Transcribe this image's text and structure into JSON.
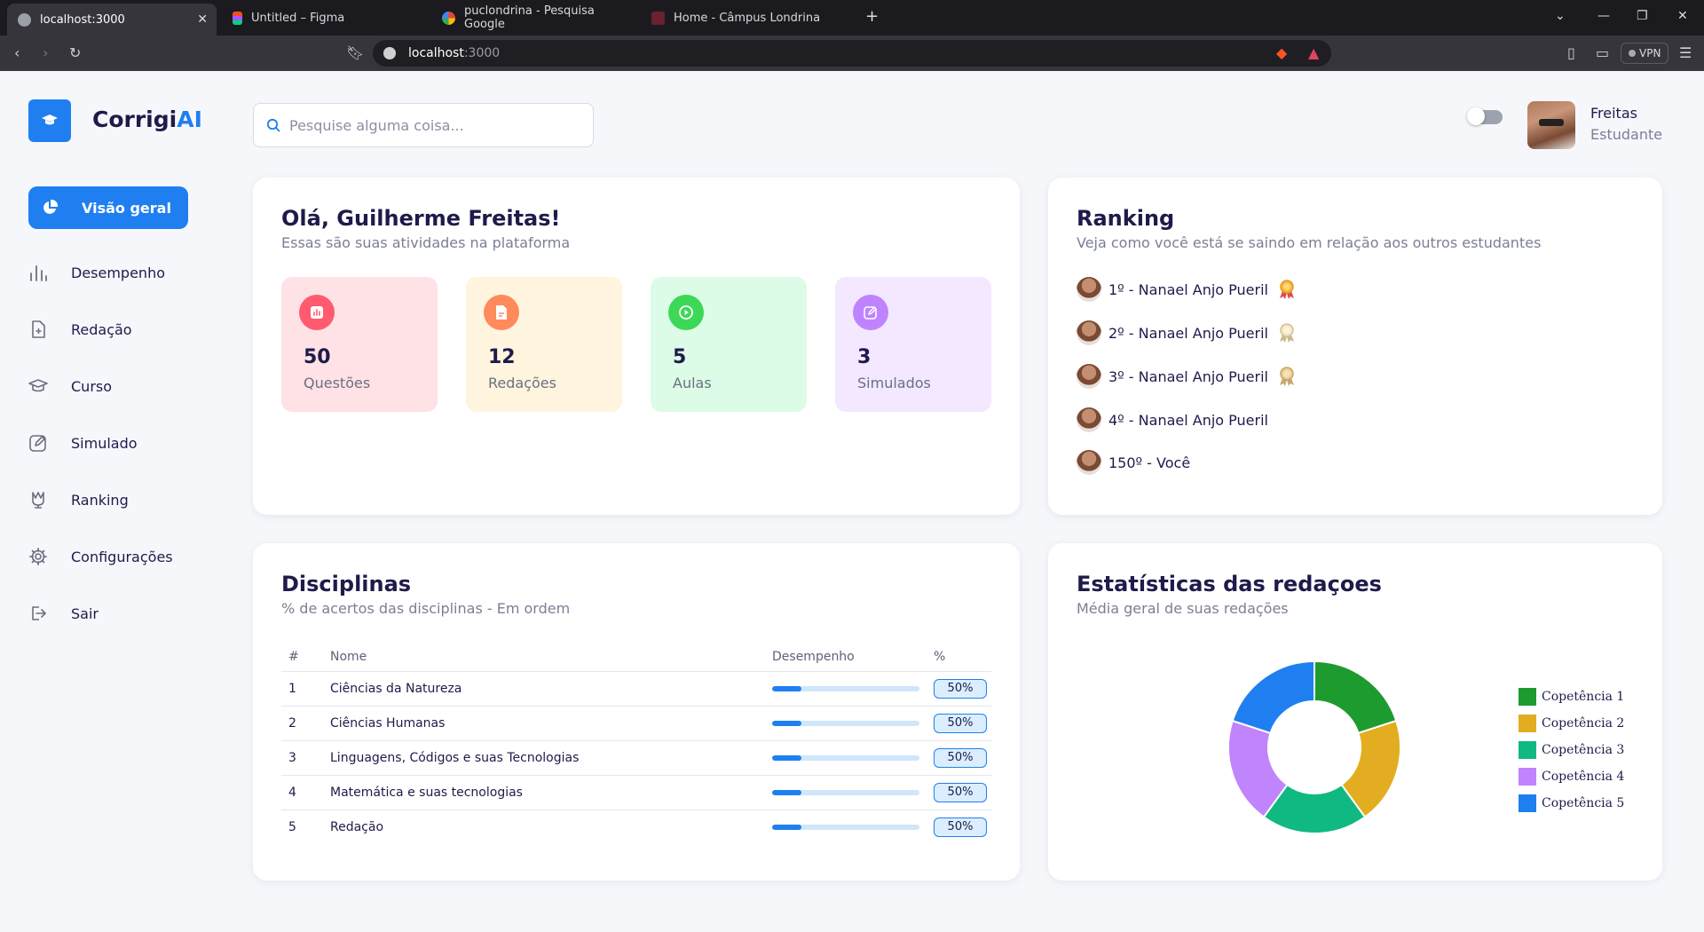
{
  "browser": {
    "tabs": [
      {
        "title": "localhost:3000",
        "active": true
      },
      {
        "title": "Untitled – Figma"
      },
      {
        "title": "puclondrina - Pesquisa Google"
      },
      {
        "title": "Home - Câmpus Londrina"
      }
    ],
    "url_host": "localhost",
    "url_port": ":3000",
    "vpn_label": "VPN"
  },
  "app": {
    "logo_main": "Corrigi",
    "logo_accent": "AI",
    "search_placeholder": "Pesquise alguma coisa...",
    "user": {
      "name": "Freitas",
      "role": "Estudante"
    }
  },
  "sidebar": {
    "active": "Visão geral",
    "items": [
      "Desempenho",
      "Redação",
      "Curso",
      "Simulado",
      "Ranking",
      "Configurações",
      "Sair"
    ]
  },
  "welcome": {
    "title": "Olá, Guilherme Freitas!",
    "subtitle": "Essas são suas atividades na plataforma",
    "stats": [
      {
        "value": "50",
        "label": "Questões",
        "color": "#ff5a6e",
        "bg": "#ffe2e5"
      },
      {
        "value": "12",
        "label": "Redações",
        "color": "#ff8a5b",
        "bg": "#fff4de"
      },
      {
        "value": "5",
        "label": "Aulas",
        "color": "#3cd856",
        "bg": "#dcfce7"
      },
      {
        "value": "3",
        "label": "Simulados",
        "color": "#bf83ff",
        "bg": "#f3e8ff"
      }
    ]
  },
  "ranking": {
    "title": "Ranking",
    "subtitle": "Veja como você está se saindo em relação aos outros estudantes",
    "entries": [
      {
        "text": "1º - Nanael Anjo Pueril",
        "medal": "gold"
      },
      {
        "text": "2º - Nanael Anjo Pueril",
        "medal": "silver"
      },
      {
        "text": "3º - Nanael Anjo Pueril",
        "medal": "bronze"
      },
      {
        "text": "4º - Nanael Anjo Pueril"
      },
      {
        "text": "150º - Você"
      }
    ]
  },
  "disciplinas": {
    "title": "Disciplinas",
    "subtitle": "% de acertos das disciplinas - Em ordem",
    "headers": [
      "#",
      "Nome",
      "Desempenho",
      "%"
    ],
    "rows": [
      {
        "n": "1",
        "name": "Ciências da Natureza",
        "progress": 0.2,
        "pct": "50%"
      },
      {
        "n": "2",
        "name": "Ciências Humanas",
        "progress": 0.2,
        "pct": "50%"
      },
      {
        "n": "3",
        "name": "Linguagens, Códigos e suas Tecnologias",
        "progress": 0.2,
        "pct": "50%"
      },
      {
        "n": "4",
        "name": "Matemática e suas tecnologias",
        "progress": 0.2,
        "pct": "50%"
      },
      {
        "n": "5",
        "name": "Redação",
        "progress": 0.2,
        "pct": "50%"
      }
    ]
  },
  "estatisticas": {
    "title": "Estatísticas das redaçoes",
    "subtitle": "Média geral de suas redações"
  },
  "chart_data": {
    "type": "pie",
    "donut": true,
    "categories": [
      "Copetência 1",
      "Copetência 2",
      "Copetência 3",
      "Copetência 4",
      "Copetência 5"
    ],
    "values": [
      20,
      20,
      20,
      20,
      20
    ],
    "colors": [
      "#1e9b2f",
      "#e3ad21",
      "#10b981",
      "#c084fc",
      "#1f7ff0"
    ],
    "legend": "right"
  }
}
